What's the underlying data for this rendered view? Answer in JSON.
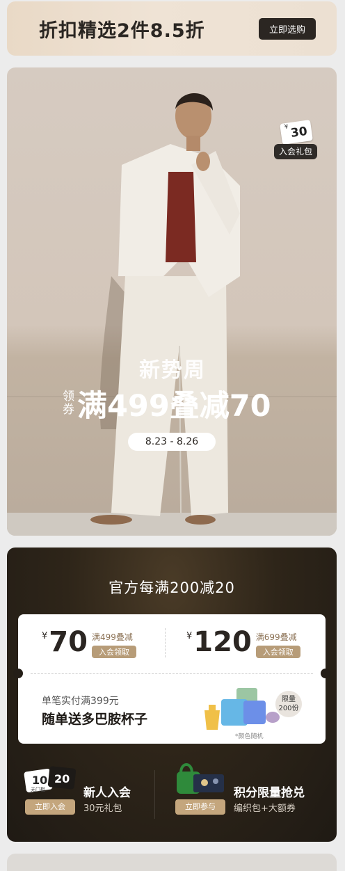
{
  "promo": {
    "title": "折扣精选2件8.5折",
    "button": "立即选购"
  },
  "hero": {
    "title": "新势周",
    "coupon_prefix_1": "领",
    "coupon_prefix_2": "券",
    "coupon_text": "满499叠减70",
    "date": "8.23 - 8.26",
    "gift_badge": {
      "yen": "¥",
      "amount": "30",
      "label": "入会礼包"
    }
  },
  "official": {
    "title": "官方每满200减20",
    "coupons": [
      {
        "yen": "¥",
        "amount": "70",
        "condition": "满499叠减",
        "tag": "入会领取"
      },
      {
        "yen": "¥",
        "amount": "120",
        "condition": "满699叠减",
        "tag": "入会领取"
      }
    ],
    "gift": {
      "subtitle": "单笔实付满399元",
      "title": "随单送多巴胺杯子",
      "limit_line1": "限量",
      "limit_line2": "200份",
      "color_note": "*颜色随机"
    },
    "member": {
      "title": "新人入会",
      "subtitle": "30元礼包",
      "button": "立即入会",
      "ticket1_amount": "10",
      "ticket1_note": "无门槛",
      "ticket2_amount": "20"
    },
    "points": {
      "title": "积分限量抢兑",
      "subtitle": "编织包+大额券",
      "button": "立即参与"
    }
  }
}
